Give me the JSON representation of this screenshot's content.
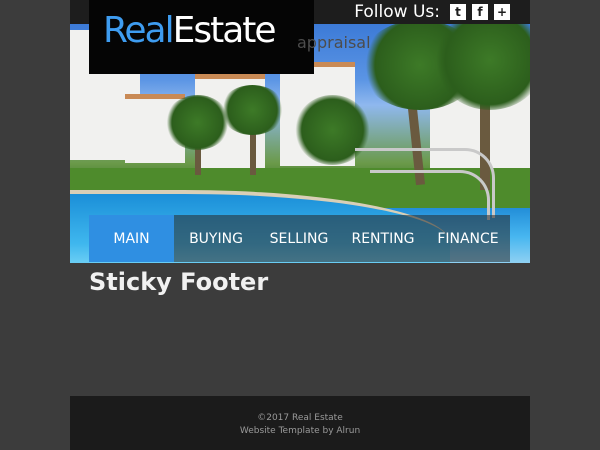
{
  "header": {
    "logo": {
      "part1": "Real",
      "part2": "Estate",
      "sub": "appraisal"
    },
    "follow_label": "Follow Us:",
    "social": [
      {
        "name": "twitter-icon",
        "glyph": "t"
      },
      {
        "name": "facebook-icon",
        "glyph": "f"
      },
      {
        "name": "google-plus-icon",
        "glyph": "+"
      }
    ]
  },
  "nav": {
    "items": [
      {
        "label": "MAIN",
        "active": true
      },
      {
        "label": "BUYING",
        "active": false
      },
      {
        "label": "SELLING",
        "active": false
      },
      {
        "label": "RENTING",
        "active": false
      },
      {
        "label": "FINANCE",
        "active": false
      }
    ]
  },
  "main": {
    "title": "Sticky Footer"
  },
  "footer": {
    "copyright": "©2017 Real Estate",
    "credit": "Website Template by Alrun"
  },
  "colors": {
    "accent": "#2f8fe2",
    "logo_blue": "#3e9cf0",
    "page_bg": "#3c3c3c",
    "footer_bg": "#1b1b1b"
  }
}
